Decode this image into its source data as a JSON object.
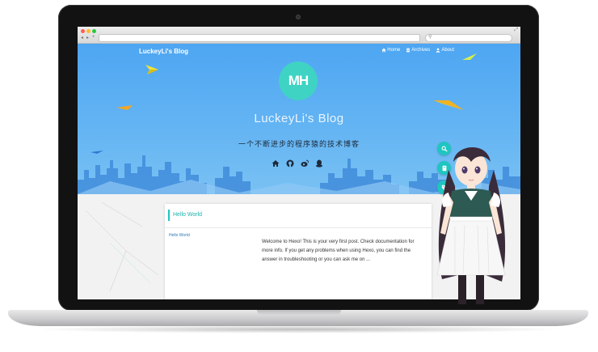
{
  "site": {
    "brand": "LuckeyLi's Blog",
    "avatar_text": "MH",
    "title": "LuckeyLi's Blog",
    "subtitle": "一个不断进步的程序猿的技术博客"
  },
  "nav": {
    "items": [
      {
        "label": "Home",
        "icon": "home-icon"
      },
      {
        "label": "Archives",
        "icon": "archive-icon"
      },
      {
        "label": "About",
        "icon": "user-icon"
      }
    ]
  },
  "social": [
    "home-icon",
    "github-icon",
    "weibo-icon",
    "qq-icon"
  ],
  "post": {
    "title": "Hello World",
    "link": "Hello World",
    "excerpt": "Welcome to Hexo! This is your very first post. Check documentation for more info. If you get any problems when using Hexo, you can find the answer in troubleshooting or you can ask me on ..."
  },
  "colors": {
    "accent": "#1fc5c0",
    "hero_top": "#4ea6f2",
    "hero_bottom": "#79c1f3",
    "avatar_bg": "#3fd3c4"
  }
}
